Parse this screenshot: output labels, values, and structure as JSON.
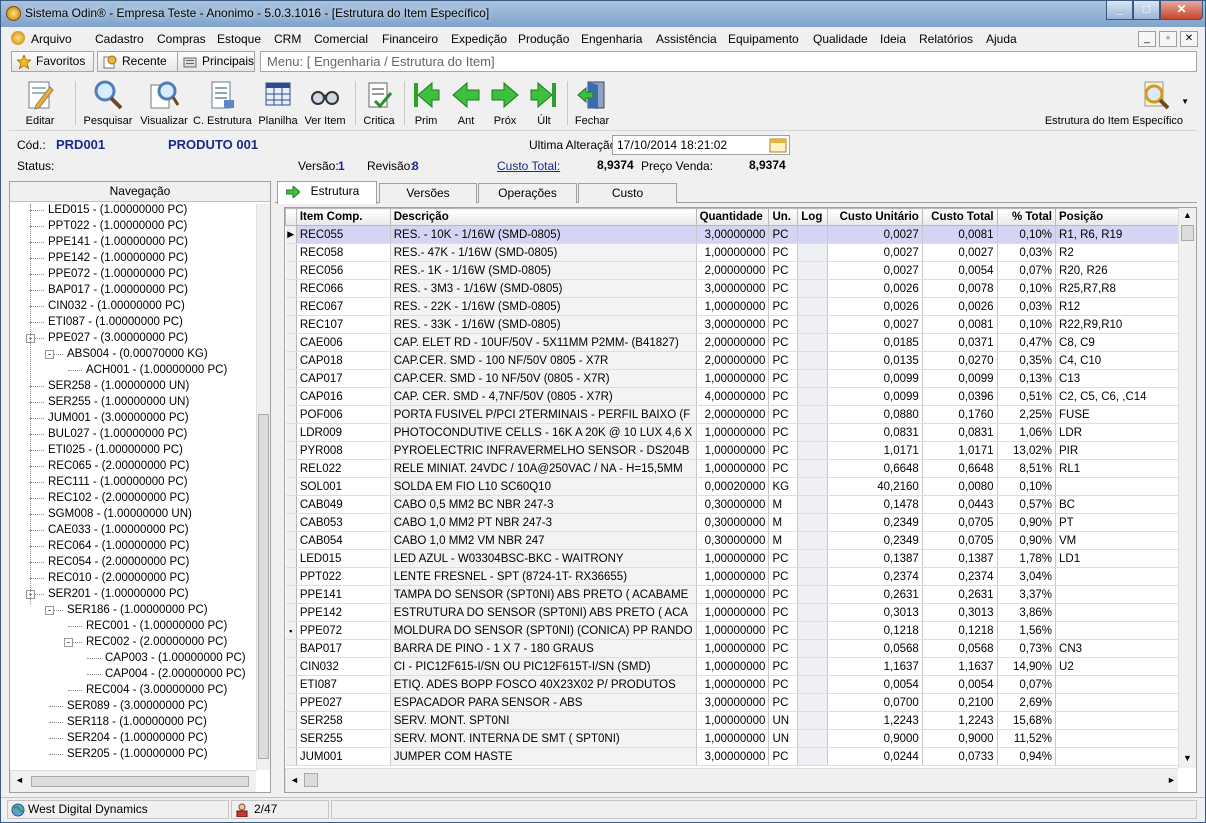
{
  "window": {
    "title": "Sistema Odin® - Empresa Teste - Anonimo - 5.0.3.1016 - [Estrutura do Item Específico]",
    "min": "_",
    "max": "□",
    "close": "✕"
  },
  "menu": [
    "Arquivo",
    "Cadastro",
    "Compras",
    "Estoque",
    "CRM",
    "Comercial",
    "Financeiro",
    "Expedição",
    "Produção",
    "Engenharia",
    "Assistência",
    "Equipamento",
    "Qualidade",
    "Ideia",
    "Relatórios",
    "Ajuda"
  ],
  "mdi": {
    "min": "_",
    "restore": "▫",
    "close": "✕"
  },
  "nav": {
    "favoritos": "Favoritos",
    "recente": "Recente",
    "principais": "Principais",
    "path": "Menu: [ Engenharia / Estrutura do Item]"
  },
  "toolbar": {
    "editar": "Editar",
    "pesquisar": "Pesquisar",
    "visualizar": "Visualizar",
    "cestrutura": "C. Estrutura",
    "planilha": "Planilha",
    "veritem": "Ver Item",
    "critica": "Critica",
    "prim": "Prim",
    "ant": "Ant",
    "prox": "Próx",
    "ult": "Últ",
    "fechar": "Fechar",
    "right_label": "Estrutura do Item Específico"
  },
  "header": {
    "cod_label": "Cód.:",
    "cod": "PRD001",
    "produto": "PRODUTO 001",
    "ult_label": "Ultima Alteração:",
    "ult_value": "17/10/2014 18:21:02",
    "status_label": "Status:",
    "versao_label": "Versão:",
    "versao": "1",
    "revisao_label": "Revisão:",
    "revisao": "8",
    "custo_label": "Custo Total:",
    "custo": "8,9374",
    "preco_label": "Preço Venda:",
    "preco": "8,9374"
  },
  "navegacao": {
    "title": "Navegação",
    "items": [
      {
        "t": "LED015 - (1.00000000 PC)",
        "l": 2
      },
      {
        "t": "PPT022 - (1.00000000 PC)",
        "l": 2
      },
      {
        "t": "PPE141 - (1.00000000 PC)",
        "l": 2
      },
      {
        "t": "PPE142 - (1.00000000 PC)",
        "l": 2
      },
      {
        "t": "PPE072 - (1.00000000 PC)",
        "l": 2
      },
      {
        "t": "BAP017 - (1.00000000 PC)",
        "l": 2
      },
      {
        "t": "CIN032 - (1.00000000 PC)",
        "l": 2
      },
      {
        "t": "ETI087 - (1.00000000 PC)",
        "l": 2
      },
      {
        "t": "PPE027 - (3.00000000 PC)",
        "l": 2,
        "exp": "-"
      },
      {
        "t": "ABS004 - (0.00070000 KG)",
        "l": 3,
        "exp": "-"
      },
      {
        "t": "ACH001 - (1.00000000 PC)",
        "l": 4
      },
      {
        "t": "SER258 - (1.00000000 UN)",
        "l": 2
      },
      {
        "t": "SER255 - (1.00000000 UN)",
        "l": 2
      },
      {
        "t": "JUM001 - (3.00000000 PC)",
        "l": 2
      },
      {
        "t": "BUL027 - (1.00000000 PC)",
        "l": 2
      },
      {
        "t": "ETI025 - (1.00000000 PC)",
        "l": 2
      },
      {
        "t": "REC065 - (2.00000000 PC)",
        "l": 2
      },
      {
        "t": "REC111 - (1.00000000 PC)",
        "l": 2
      },
      {
        "t": "REC102 - (2.00000000 PC)",
        "l": 2
      },
      {
        "t": "SGM008 - (1.00000000 UN)",
        "l": 2
      },
      {
        "t": "CAE033 - (1.00000000 PC)",
        "l": 2
      },
      {
        "t": "REC064 - (1.00000000 PC)",
        "l": 2
      },
      {
        "t": "REC054 - (2.00000000 PC)",
        "l": 2
      },
      {
        "t": "REC010 - (2.00000000 PC)",
        "l": 2
      },
      {
        "t": "SER201 - (1.00000000 PC)",
        "l": 2,
        "exp": "-"
      },
      {
        "t": "SER186 - (1.00000000 PC)",
        "l": 3,
        "exp": "-"
      },
      {
        "t": "REC001 - (1.00000000 PC)",
        "l": 4
      },
      {
        "t": "REC002 - (2.00000000 PC)",
        "l": 4,
        "exp": "-"
      },
      {
        "t": "CAP003 - (1.00000000 PC)",
        "l": 5
      },
      {
        "t": "CAP004 - (2.00000000 PC)",
        "l": 5
      },
      {
        "t": "REC004 - (3.00000000 PC)",
        "l": 4
      },
      {
        "t": "SER089 - (3.00000000 PC)",
        "l": 3
      },
      {
        "t": "SER118 - (1.00000000 PC)",
        "l": 3
      },
      {
        "t": "SER204 - (1.00000000 PC)",
        "l": 3
      },
      {
        "t": "SER205 - (1.00000000 PC)",
        "l": 3
      }
    ]
  },
  "tabs": [
    "Estrutura",
    "Versões",
    "Operações",
    "Custo"
  ],
  "columns": [
    "Item Comp.",
    "Descrição",
    "Quantidade",
    "Un.",
    "Log",
    "Custo Unitário",
    "Custo Total",
    "% Total",
    "Posição"
  ],
  "rows": [
    [
      "REC055",
      "RES. - 10K - 1/16W (SMD-0805)",
      "3,00000000",
      "PC",
      "",
      "0,0027",
      "0,0081",
      "0,10%",
      "R1, R6, R19"
    ],
    [
      "REC058",
      "RES.- 47K - 1/16W (SMD-0805)",
      "1,00000000",
      "PC",
      "",
      "0,0027",
      "0,0027",
      "0,03%",
      "R2"
    ],
    [
      "REC056",
      "RES.- 1K - 1/16W (SMD-0805)",
      "2,00000000",
      "PC",
      "",
      "0,0027",
      "0,0054",
      "0,07%",
      "R20, R26"
    ],
    [
      "REC066",
      "RES. - 3M3 - 1/16W (SMD-0805)",
      "3,00000000",
      "PC",
      "",
      "0,0026",
      "0,0078",
      "0,10%",
      "R25,R7,R8"
    ],
    [
      "REC067",
      "RES. - 22K - 1/16W (SMD-0805)",
      "1,00000000",
      "PC",
      "",
      "0,0026",
      "0,0026",
      "0,03%",
      "R12"
    ],
    [
      "REC107",
      "RES. - 33K - 1/16W (SMD-0805)",
      "3,00000000",
      "PC",
      "",
      "0,0027",
      "0,0081",
      "0,10%",
      "R22,R9,R10"
    ],
    [
      "CAE006",
      "CAP. ELET RD - 10UF/50V - 5X11MM P2MM- (B41827)",
      "2,00000000",
      "PC",
      "",
      "0,0185",
      "0,0371",
      "0,47%",
      "C8, C9"
    ],
    [
      "CAP018",
      "CAP.CER. SMD - 100 NF/50V 0805 - X7R",
      "2,00000000",
      "PC",
      "",
      "0,0135",
      "0,0270",
      "0,35%",
      "C4, C10"
    ],
    [
      "CAP017",
      "CAP.CER. SMD - 10 NF/50V (0805 - X7R)",
      "1,00000000",
      "PC",
      "",
      "0,0099",
      "0,0099",
      "0,13%",
      "C13"
    ],
    [
      "CAP016",
      "CAP. CER. SMD - 4,7NF/50V (0805 - X7R)",
      "4,00000000",
      "PC",
      "",
      "0,0099",
      "0,0396",
      "0,51%",
      "C2, C5, C6, ,C14"
    ],
    [
      "POF006",
      "PORTA FUSIVEL P/PCI 2TERMINAIS - PERFIL BAIXO (F",
      "2,00000000",
      "PC",
      "",
      "0,0880",
      "0,1760",
      "2,25%",
      "FUSE"
    ],
    [
      "LDR009",
      "PHOTOCONDUTIVE CELLS - 16K A 20K @ 10 LUX 4,6 X",
      "1,00000000",
      "PC",
      "",
      "0,0831",
      "0,0831",
      "1,06%",
      "LDR"
    ],
    [
      "PYR008",
      "PYROELECTRIC INFRAVERMELHO SENSOR - DS204B",
      "1,00000000",
      "PC",
      "",
      "1,0171",
      "1,0171",
      "13,02%",
      "PIR"
    ],
    [
      "REL022",
      "RELE MINIAT. 24VDC / 10A@250VAC / NA - H=15,5MM",
      "1,00000000",
      "PC",
      "",
      "0,6648",
      "0,6648",
      "8,51%",
      "RL1"
    ],
    [
      "SOL001",
      "SOLDA EM FIO L10 SC60Q10",
      "0,00020000",
      "KG",
      "",
      "40,2160",
      "0,0080",
      "0,10%",
      ""
    ],
    [
      "CAB049",
      "CABO 0,5 MM2 BC NBR 247-3",
      "0,30000000",
      "M",
      "",
      "0,1478",
      "0,0443",
      "0,57%",
      "BC"
    ],
    [
      "CAB053",
      "CABO 1,0 MM2 PT NBR 247-3",
      "0,30000000",
      "M",
      "",
      "0,2349",
      "0,0705",
      "0,90%",
      "PT"
    ],
    [
      "CAB054",
      "CABO 1,0 MM2 VM NBR 247",
      "0,30000000",
      "M",
      "",
      "0,2349",
      "0,0705",
      "0,90%",
      "VM"
    ],
    [
      "LED015",
      "LED AZUL - W03304BSC-BKC - WAITRONY",
      "1,00000000",
      "PC",
      "",
      "0,1387",
      "0,1387",
      "1,78%",
      "LD1"
    ],
    [
      "PPT022",
      "LENTE FRESNEL - SPT (8724-1T- RX36655)",
      "1,00000000",
      "PC",
      "",
      "0,2374",
      "0,2374",
      "3,04%",
      ""
    ],
    [
      "PPE141",
      "TAMPA DO SENSOR (SPT0NI) ABS PRETO ( ACABAME",
      "1,00000000",
      "PC",
      "",
      "0,2631",
      "0,2631",
      "3,37%",
      ""
    ],
    [
      "PPE142",
      "ESTRUTURA DO SENSOR (SPT0NI) ABS PRETO ( ACA",
      "1,00000000",
      "PC",
      "",
      "0,3013",
      "0,3013",
      "3,86%",
      ""
    ],
    [
      "PPE072",
      "MOLDURA DO SENSOR (SPT0NI) (CONICA) PP RANDO",
      "1,00000000",
      "PC",
      "",
      "0,1218",
      "0,1218",
      "1,56%",
      ""
    ],
    [
      "BAP017",
      "BARRA DE PINO - 1 X 7 - 180 GRAUS",
      "1,00000000",
      "PC",
      "",
      "0,0568",
      "0,0568",
      "0,73%",
      "CN3"
    ],
    [
      "CIN032",
      "CI - PIC12F615-I/SN OU PIC12F615T-I/SN (SMD)",
      "1,00000000",
      "PC",
      "",
      "1,1637",
      "1,1637",
      "14,90%",
      "U2"
    ],
    [
      "ETI087",
      "ETIQ. ADES BOPP FOSCO 40X23X02 P/ PRODUTOS",
      "1,00000000",
      "PC",
      "",
      "0,0054",
      "0,0054",
      "0,07%",
      ""
    ],
    [
      "PPE027",
      "ESPACADOR PARA SENSOR - ABS",
      "3,00000000",
      "PC",
      "",
      "0,0700",
      "0,2100",
      "2,69%",
      ""
    ],
    [
      "SER258",
      "SERV. MONT. SPT0NI",
      "1,00000000",
      "UN",
      "",
      "1,2243",
      "1,2243",
      "15,68%",
      ""
    ],
    [
      "SER255",
      "SERV. MONT. INTERNA DE SMT ( SPT0NI)",
      "1,00000000",
      "UN",
      "",
      "0,9000",
      "0,9000",
      "11,52%",
      ""
    ],
    [
      "JUM001",
      "JUMPER  COM HASTE",
      "3,00000000",
      "PC",
      "",
      "0,0244",
      "0,0733",
      "0,94%",
      ""
    ]
  ],
  "status": {
    "company": "West Digital Dynamics",
    "page": "2/47"
  }
}
